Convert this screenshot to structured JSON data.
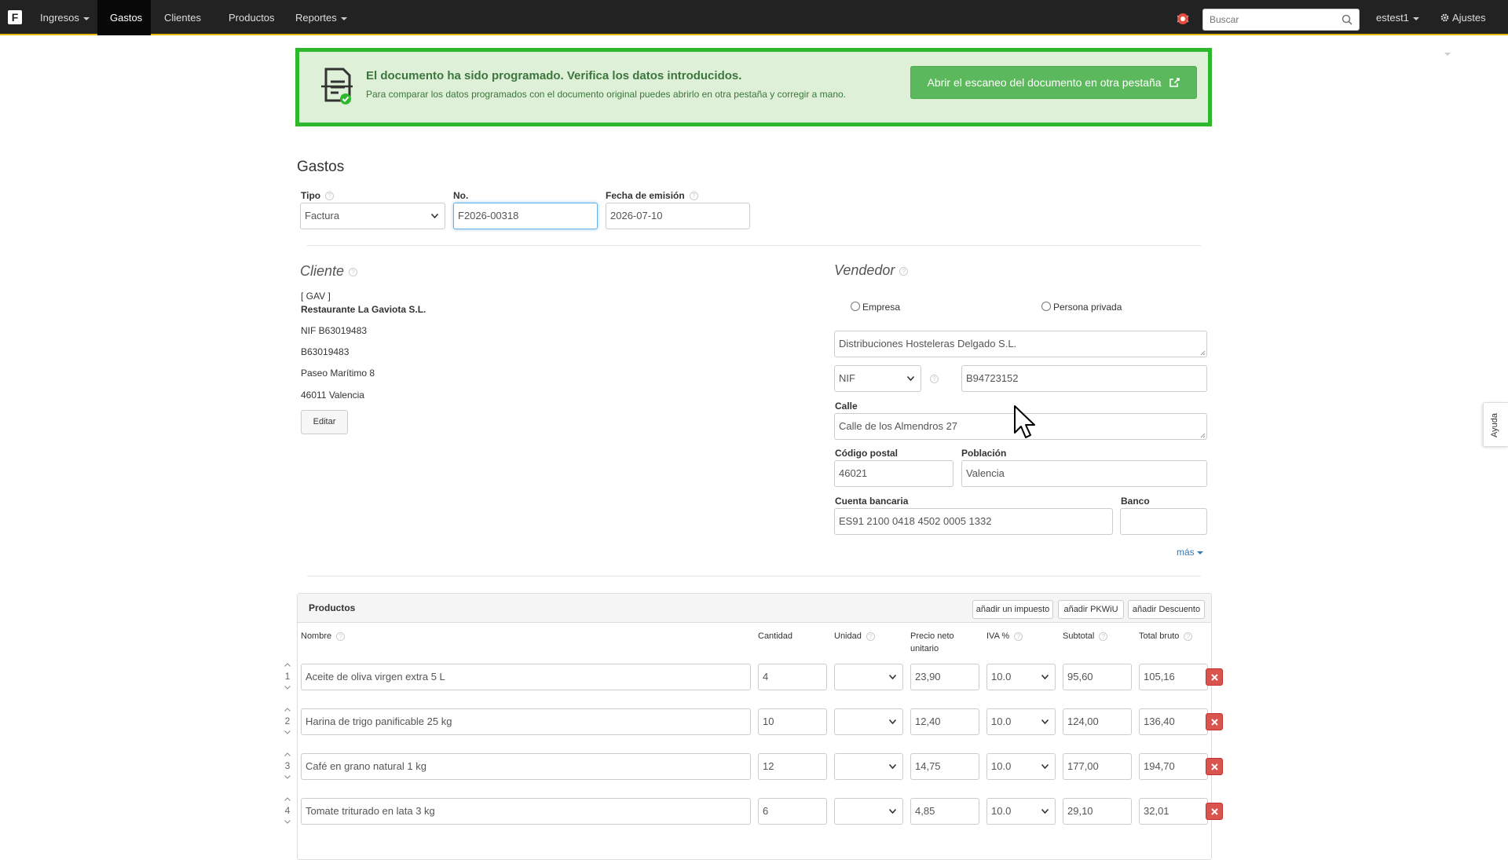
{
  "navbar": {
    "logo": "F",
    "items": [
      {
        "label": "Ingresos",
        "dropdown": true
      },
      {
        "label": "Gastos",
        "active": true
      },
      {
        "label": "Clientes"
      },
      {
        "label": "Productos"
      },
      {
        "label": "Reportes",
        "dropdown": true
      }
    ],
    "search_placeholder": "Buscar",
    "user": "estest1",
    "settings": "Ajustes"
  },
  "alert": {
    "title": "El documento ha sido programado. Verifica los datos introducidos.",
    "subtitle": "Para comparar los datos programados con el documento original puedes abrirlo en otra pestaña y corregir a mano.",
    "button": "Abrir el escaneo del documento en otra pestaña"
  },
  "page_title": "Gastos",
  "header_fields": {
    "tipo_label": "Tipo",
    "tipo_value": "Factura",
    "no_label": "No.",
    "no_value": "F2026-00318",
    "fecha_label": "Fecha de emisión",
    "fecha_value": "2026-07-10"
  },
  "cliente": {
    "title": "Cliente",
    "code": "[ GAV ]",
    "name": "Restaurante La Gaviota S.L.",
    "nif": "NIF B63019483",
    "tax_id": "B63019483",
    "street": "Paseo Marítimo 8",
    "city": "46011 Valencia",
    "edit_button": "Editar"
  },
  "vendedor": {
    "title": "Vendedor",
    "radio_empresa": "Empresa",
    "radio_persona": "Persona privada",
    "name": "Distribuciones Hosteleras Delgado S.L.",
    "id_type": "NIF",
    "id_value": "B94723152",
    "calle_label": "Calle",
    "calle_value": "Calle de los Almendros 27",
    "cp_label": "Código postal",
    "cp_value": "46021",
    "poblacion_label": "Población",
    "poblacion_value": "Valencia",
    "cuenta_label": "Cuenta bancaria",
    "cuenta_value": "ES91 2100 0418 4502 0005 1332",
    "banco_label": "Banco",
    "banco_value": "",
    "mas": "más"
  },
  "productos": {
    "title": "Productos",
    "buttons": [
      "añadir un impuesto",
      "añadir PKWiU",
      "añadir Descuento"
    ],
    "columns": {
      "nombre": "Nombre",
      "cantidad": "Cantidad",
      "unidad": "Unidad",
      "precio": "Precio neto unitario",
      "iva": "IVA %",
      "subtotal": "Subtotal",
      "total": "Total bruto"
    },
    "rows": [
      {
        "num": "1",
        "nombre": "Aceite de oliva virgen extra 5 L",
        "cantidad": "4",
        "unidad": "",
        "precio": "23,90",
        "iva": "10.0",
        "subtotal": "95,60",
        "total": "105,16"
      },
      {
        "num": "2",
        "nombre": "Harina de trigo panificable 25 kg",
        "cantidad": "10",
        "unidad": "",
        "precio": "12,40",
        "iva": "10.0",
        "subtotal": "124,00",
        "total": "136,40"
      },
      {
        "num": "3",
        "nombre": "Café en grano natural 1 kg",
        "cantidad": "12",
        "unidad": "",
        "precio": "14,75",
        "iva": "10.0",
        "subtotal": "177,00",
        "total": "194,70"
      },
      {
        "num": "4",
        "nombre": "Tomate triturado en lata 3 kg",
        "cantidad": "6",
        "unidad": "",
        "precio": "4,85",
        "iva": "10.0",
        "subtotal": "29,10",
        "total": "32,01"
      }
    ]
  },
  "ayuda": "Ayuda",
  "colors": {
    "success_border": "#2eb82e",
    "success_bg": "#dff0d8",
    "danger": "#d9534f",
    "nav_bg": "#222222"
  }
}
